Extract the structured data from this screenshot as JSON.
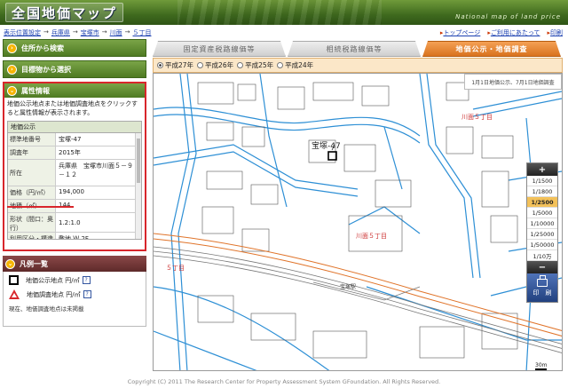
{
  "header": {
    "logo_text": "全国地価マップ",
    "subtitle": "National map of land price"
  },
  "breadcrumb": {
    "items": [
      "表示位置設定",
      "兵庫県",
      "宝塚市",
      "川面",
      "５丁目"
    ],
    "separator": "→"
  },
  "toplinks": [
    {
      "label": "トップページ"
    },
    {
      "label": "ご利用にあたって"
    },
    {
      "label": "印刷"
    }
  ],
  "sidebar": {
    "nav": [
      {
        "label": "住所から検索"
      },
      {
        "label": "目標物から選択"
      }
    ],
    "attr_panel": {
      "title": "属性情報",
      "description": "地価公示地点または地価調査地点をクリックすると属性情報が表示されます。",
      "table_title": "地価公示",
      "rows": [
        {
          "key": "標準地番号",
          "value": "宝塚-47"
        },
        {
          "key": "調査年",
          "value": "2015年"
        },
        {
          "key": "所在",
          "value": "兵庫県　宝塚市川面５－９－１２"
        },
        {
          "key": "価格（円/㎡）",
          "value": "194,000"
        },
        {
          "key": "地積（㎡）",
          "value": "144"
        },
        {
          "key": "形状（間口：奥行）",
          "value": "1.2:1.0"
        },
        {
          "key": "利用区分・構造",
          "value": "敷地 Ｗ 2F"
        }
      ]
    },
    "legend": {
      "title": "凡例一覧",
      "items": [
        {
          "label": "地価公示地点 円/㎡",
          "icon": "square-icon"
        },
        {
          "label": "地価調査地点 円/㎡",
          "icon": "triangle-icon"
        }
      ],
      "note": "現在、地価調査地点は未掲載"
    }
  },
  "tabs": [
    {
      "label": "固定資産税路線価等",
      "active": false
    },
    {
      "label": "相続税路線価等",
      "active": false
    },
    {
      "label": "地価公示・地価調査",
      "active": true
    }
  ],
  "years": [
    {
      "label": "平成27年",
      "selected": true
    },
    {
      "label": "平成26年",
      "selected": false
    },
    {
      "label": "平成25年",
      "selected": false
    },
    {
      "label": "平成24年",
      "selected": false
    }
  ],
  "map": {
    "note": "1月1日地価公示、7月1日地価調査",
    "labels": {
      "marker": "宝塚-47",
      "district1": "川面５丁目",
      "district2": "川面５丁目",
      "district3": "５丁目",
      "station": "宝塚駅",
      "scalebar": "30m"
    },
    "scales": [
      "1/1500",
      "1/1800",
      "1/2500",
      "1/5000",
      "1/10000",
      "1/25000",
      "1/50000",
      "1/10万"
    ],
    "selected_scale": "1/2500",
    "print_label": "印　刷"
  },
  "footer": "Copyright (C) 2011 The Research Center for Property Assessment System GFoundation. All Rights Reserved.",
  "colors": {
    "accent_green": "#4e7a22",
    "active_tab": "#d9731e",
    "highlight_red": "#d8262b",
    "map_road": "#2d8fd5",
    "rail": "#e0742a"
  }
}
